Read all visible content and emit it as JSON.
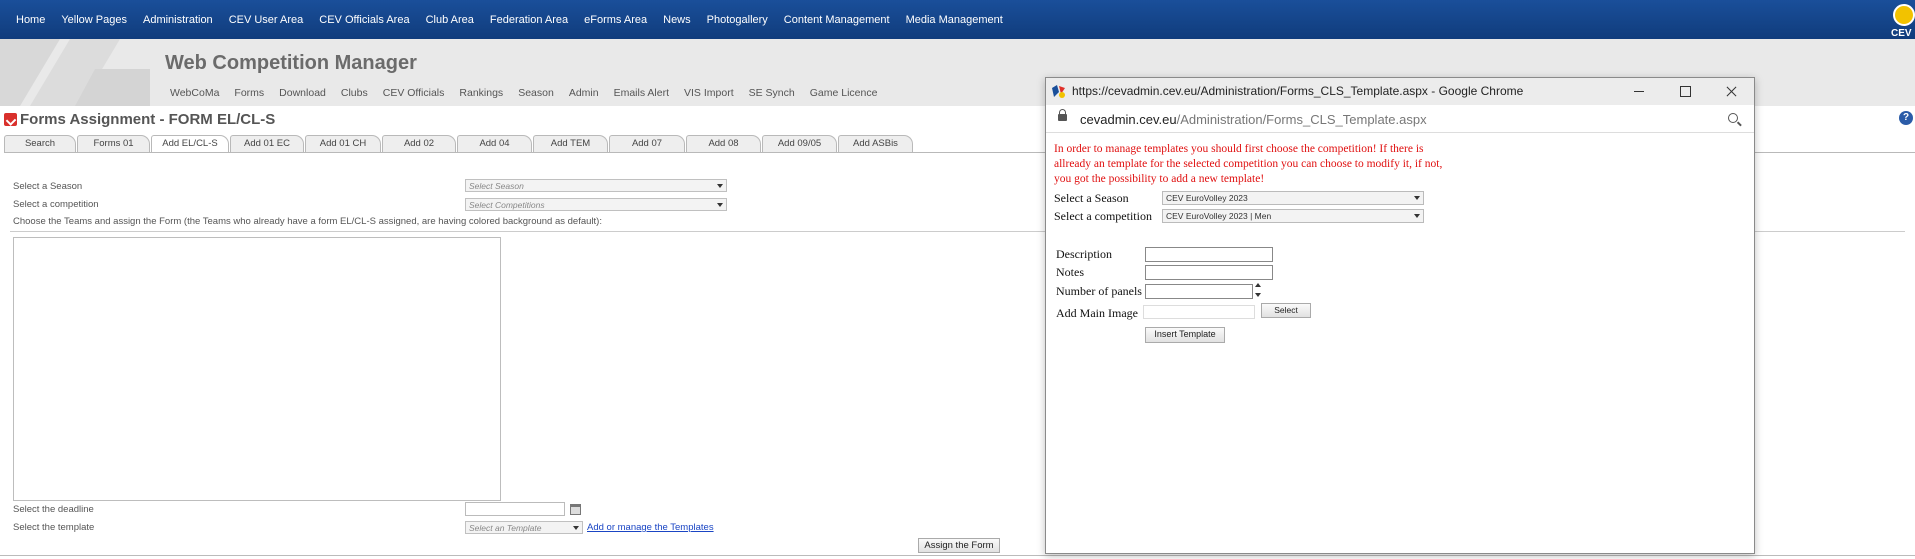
{
  "topnav": {
    "items": [
      "Home",
      "Yellow Pages",
      "Administration",
      "CEV User Area",
      "CEV Officials Area",
      "Club Area",
      "Federation Area",
      "eForms Area",
      "News",
      "Photogallery",
      "Content Management",
      "Media Management"
    ],
    "logo_text": "CEV"
  },
  "header": {
    "app_title": "Web Competition Manager",
    "subnav": [
      "WebCoMa",
      "Forms",
      "Download",
      "Clubs",
      "CEV Officials",
      "Rankings",
      "Season",
      "Admin",
      "Emails Alert",
      "VIS Import",
      "SE Synch",
      "Game Licence"
    ]
  },
  "page": {
    "title": "Forms Assignment - FORM EL/CL-S",
    "help_symbol": "?"
  },
  "tabs": {
    "items": [
      "Search",
      "Forms 01",
      "Add EL/CL-S",
      "Add 01 EC",
      "Add 01 CH",
      "Add 02",
      "Add 04",
      "Add TEM",
      "Add 07",
      "Add 08",
      "Add 09/05",
      "Add ASBis"
    ],
    "active": "Add EL/CL-S"
  },
  "form": {
    "season_label": "Select a Season",
    "season_placeholder": "Select Season",
    "competition_label": "Select a competition",
    "competition_placeholder": "Select Competitions",
    "teams_instruction": "Choose the Teams and assign the Form (the Teams who already have a form EL/CL-S assigned, are having colored background as default):",
    "deadline_label": "Select the deadline",
    "template_label": "Select the template",
    "template_placeholder": "Select an Template",
    "manage_templates_link": "Add or manage the Templates",
    "assign_button": "Assign the Form"
  },
  "popup": {
    "window_title": "https://cevadmin.cev.eu/Administration/Forms_CLS_Template.aspx - Google Chrome",
    "address_domain": "cevadmin.cev.eu",
    "address_path": "/Administration/Forms_CLS_Template.aspx",
    "message": "In order to manage templates you should first choose the competition! If there is allready an template for the selected competition you can choose to modify it, if not, you got the possibility to add a new template!",
    "season_label": "Select a Season",
    "season_value": "CEV EuroVolley 2023",
    "competition_label": "Select a competition",
    "competition_value": "CEV EuroVolley 2023 | Men",
    "description_label": "Description",
    "notes_label": "Notes",
    "panels_label": "Number of panels",
    "main_image_label": "Add Main Image",
    "select_button": "Select",
    "insert_button": "Insert Template"
  },
  "colors": {
    "nav_bg": "#1a4f9a",
    "header_bg": "#e9e9e9",
    "message_red": "#e01010",
    "link_blue": "#1a45c4"
  }
}
